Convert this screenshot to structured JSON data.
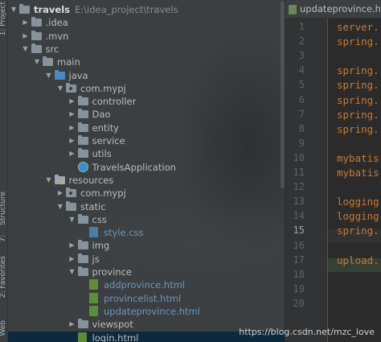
{
  "side_strip": {
    "labels": [
      "1: Project",
      "Structure",
      "7:",
      "2: Favorites",
      "Web"
    ]
  },
  "tree": [
    {
      "depth": 0,
      "arrow": "down",
      "icon": "folder",
      "label": "travels",
      "bold": true,
      "path": "E:\\idea_project\\travels"
    },
    {
      "depth": 1,
      "arrow": "right",
      "icon": "folder",
      "label": ".idea"
    },
    {
      "depth": 1,
      "arrow": "right",
      "icon": "folder",
      "label": ".mvn"
    },
    {
      "depth": 1,
      "arrow": "down",
      "icon": "folder",
      "label": "src"
    },
    {
      "depth": 2,
      "arrow": "down",
      "icon": "folder",
      "label": "main"
    },
    {
      "depth": 3,
      "arrow": "down",
      "icon": "folder-src",
      "label": "java"
    },
    {
      "depth": 4,
      "arrow": "down",
      "icon": "folder-pkg",
      "label": "com.mypj"
    },
    {
      "depth": 5,
      "arrow": "right",
      "icon": "folder",
      "label": "controller"
    },
    {
      "depth": 5,
      "arrow": "right",
      "icon": "folder",
      "label": "Dao"
    },
    {
      "depth": 5,
      "arrow": "right",
      "icon": "folder",
      "label": "entity"
    },
    {
      "depth": 5,
      "arrow": "right",
      "icon": "folder",
      "label": "service"
    },
    {
      "depth": 5,
      "arrow": "right",
      "icon": "folder",
      "label": "utils"
    },
    {
      "depth": 5,
      "arrow": "none",
      "icon": "app",
      "label": "TravelsApplication"
    },
    {
      "depth": 3,
      "arrow": "down",
      "icon": "folder-res",
      "label": "resources"
    },
    {
      "depth": 4,
      "arrow": "right",
      "icon": "folder-pkg",
      "label": "com.mypj"
    },
    {
      "depth": 4,
      "arrow": "down",
      "icon": "folder",
      "label": "static"
    },
    {
      "depth": 5,
      "arrow": "down",
      "icon": "folder",
      "label": "css"
    },
    {
      "depth": 6,
      "arrow": "none",
      "icon": "css",
      "label": "style.css",
      "blue": true
    },
    {
      "depth": 5,
      "arrow": "right",
      "icon": "folder",
      "label": "img"
    },
    {
      "depth": 5,
      "arrow": "right",
      "icon": "folder",
      "label": "js"
    },
    {
      "depth": 5,
      "arrow": "down",
      "icon": "folder",
      "label": "province"
    },
    {
      "depth": 6,
      "arrow": "none",
      "icon": "html",
      "label": "addprovince.html",
      "blue": true
    },
    {
      "depth": 6,
      "arrow": "none",
      "icon": "html",
      "label": "provincelist.html",
      "blue": true
    },
    {
      "depth": 6,
      "arrow": "none",
      "icon": "html",
      "label": "updateprovince.html",
      "blue": true
    },
    {
      "depth": 5,
      "arrow": "right",
      "icon": "folder",
      "label": "viewspot"
    },
    {
      "depth": 5,
      "arrow": "none",
      "icon": "html",
      "label": "login.html",
      "selected": true
    }
  ],
  "editor": {
    "tab_label": "updateprovince.htm",
    "lines": [
      {
        "n": "1",
        "code": "server."
      },
      {
        "n": "2",
        "code": "spring."
      },
      {
        "n": "3",
        "code": ""
      },
      {
        "n": "4",
        "code": "spring."
      },
      {
        "n": "5",
        "code": "spring."
      },
      {
        "n": "6",
        "code": "spring."
      },
      {
        "n": "7",
        "code": "spring."
      },
      {
        "n": "8",
        "code": "spring."
      },
      {
        "n": "9",
        "code": ""
      },
      {
        "n": "10",
        "code": "mybatis"
      },
      {
        "n": "11",
        "code": "mybatis"
      },
      {
        "n": "12",
        "code": ""
      },
      {
        "n": "13",
        "code": "logging"
      },
      {
        "n": "14",
        "code": "logging"
      },
      {
        "n": "15",
        "code": "spring."
      },
      {
        "n": "16",
        "code": ""
      },
      {
        "n": "17",
        "code": "upload."
      },
      {
        "n": "18",
        "code": ""
      },
      {
        "n": "19",
        "code": ""
      },
      {
        "n": "20",
        "code": ""
      }
    ],
    "current_line": "15"
  },
  "watermark": "https://blog.csdn.net/mzc_love"
}
